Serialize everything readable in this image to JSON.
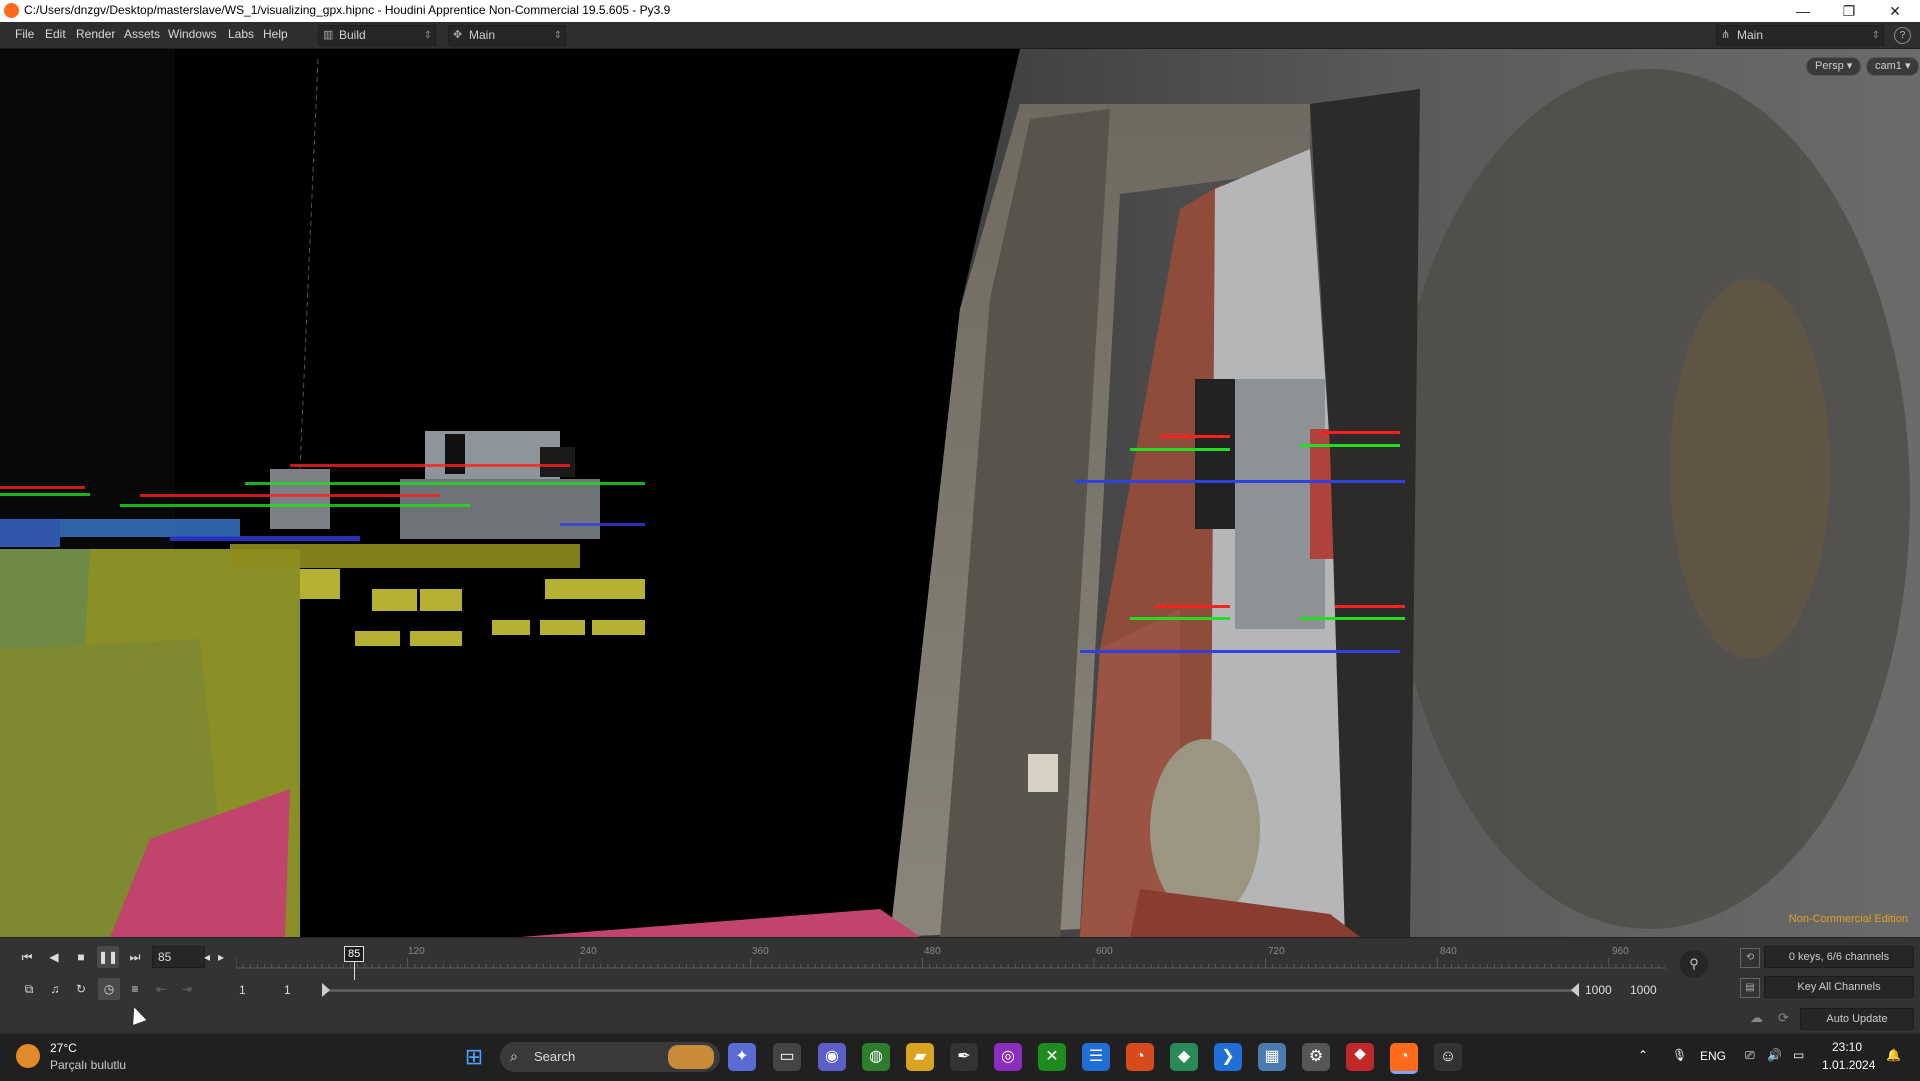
{
  "titlebar": {
    "title": "C:/Users/dnzgv/Desktop/masterslave/WS_1/visualizing_gpx.hipnc - Houdini Apprentice Non-Commercial 19.5.605 - Py3.9",
    "minimize": "—",
    "restore": "❐",
    "close": "✕"
  },
  "menubar": {
    "items": [
      "File",
      "Edit",
      "Render",
      "Assets",
      "Windows",
      "Labs",
      "Help"
    ],
    "desktop_build": "Build",
    "desktop_main": "Main",
    "right_main": "Main"
  },
  "viewport": {
    "persp_label": "Persp ▾",
    "cam_label": "cam1 ▾",
    "non_commercial": "Non-Commercial Edition"
  },
  "playbar": {
    "current_frame": "85",
    "marker_frame": "85",
    "tick_labels": [
      "120",
      "240",
      "360",
      "480",
      "600",
      "720",
      "840",
      "960"
    ],
    "range_start": "1",
    "range_start2": "1",
    "range_end": "1000",
    "range_end2": "1000",
    "keys_channels": "0 keys, 6/6 channels",
    "key_all_channels": "Key All Channels",
    "auto_update": "Auto Update"
  },
  "taskbar": {
    "weather_temp": "27°C",
    "weather_desc": "Parçalı bulutlu",
    "search_placeholder": "Search",
    "lang": "ENG",
    "time": "23:10",
    "date": "1.01.2024"
  },
  "colors": {
    "accent_orange": "#ff6b1a",
    "nc_label": "#e0a020"
  }
}
